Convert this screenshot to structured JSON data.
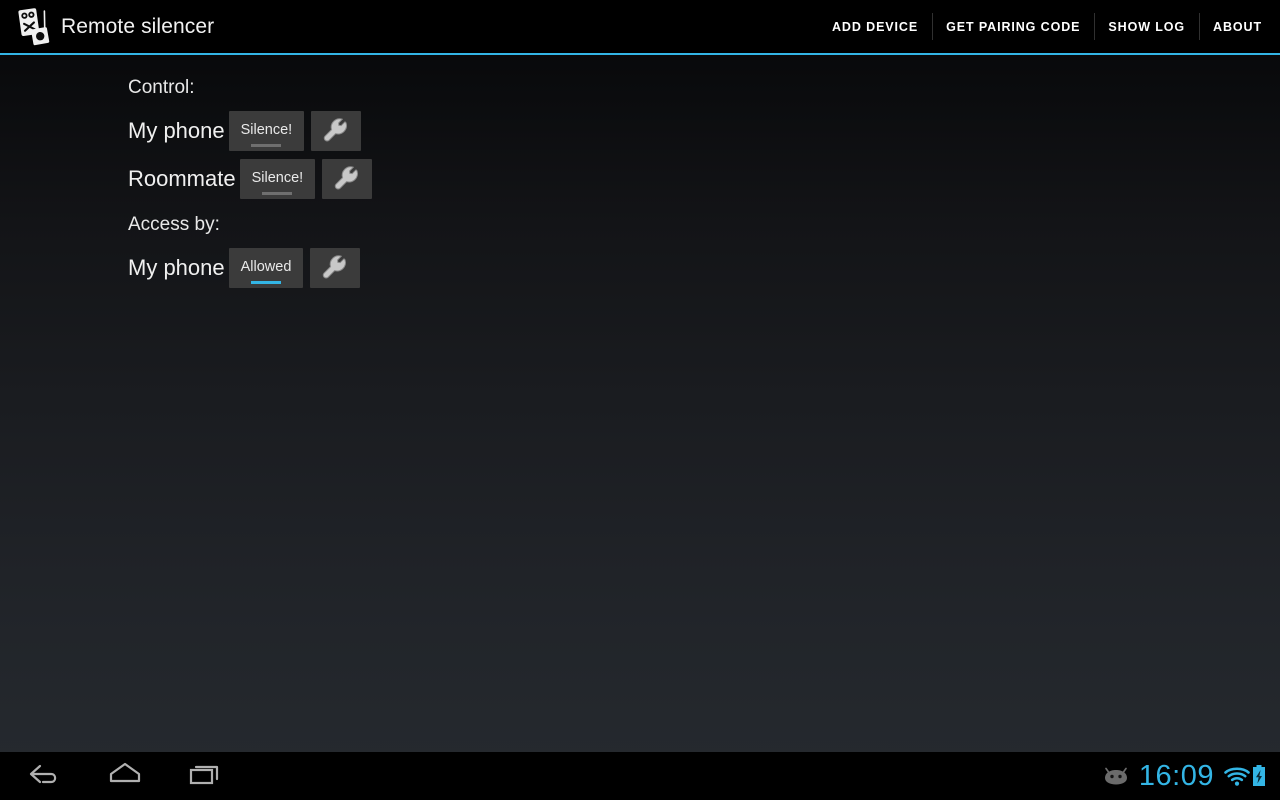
{
  "app": {
    "title": "Remote silencer",
    "icon": "remote-silencer-app-icon"
  },
  "action_bar": {
    "actions": [
      {
        "label": "ADD DEVICE",
        "name": "add-device"
      },
      {
        "label": "GET PAIRING CODE",
        "name": "get-pairing-code"
      },
      {
        "label": "SHOW LOG",
        "name": "show-log"
      },
      {
        "label": "ABOUT",
        "name": "about"
      }
    ]
  },
  "sections": [
    {
      "header": "Control:",
      "rows": [
        {
          "label": "My phone",
          "action_label": "Silence!",
          "state": "inactive",
          "settings_icon": "wrench-icon"
        },
        {
          "label": "Roommate",
          "action_label": "Silence!",
          "state": "inactive",
          "settings_icon": "wrench-icon"
        }
      ]
    },
    {
      "header": "Access by:",
      "rows": [
        {
          "label": "My phone",
          "action_label": "Allowed",
          "state": "active",
          "settings_icon": "wrench-icon"
        }
      ]
    }
  ],
  "nav_bar": {
    "buttons": [
      {
        "name": "back-button",
        "icon": "back-arrow-icon"
      },
      {
        "name": "home-button",
        "icon": "home-icon"
      },
      {
        "name": "recents-button",
        "icon": "recent-apps-icon"
      }
    ],
    "status": {
      "notification_icon": "android-bug-icon",
      "clock": "16:09",
      "wifi_icon": "wifi-full-icon",
      "battery_icon": "battery-charging-icon"
    }
  },
  "colors": {
    "accent": "#33b5e5",
    "action_bar_bg": "#000000",
    "button_bg": "#3b3b3b",
    "inactive_underline": "#6f6f6f"
  }
}
